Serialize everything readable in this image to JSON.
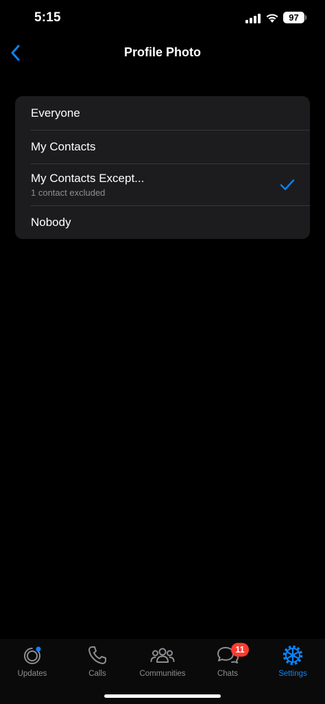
{
  "status_bar": {
    "time": "5:15",
    "battery": "97"
  },
  "nav": {
    "title": "Profile Photo",
    "back_icon": "chevron-left-icon"
  },
  "options": [
    {
      "label": "Everyone",
      "subtitle": "",
      "selected": false
    },
    {
      "label": "My Contacts",
      "subtitle": "",
      "selected": false
    },
    {
      "label": "My Contacts Except...",
      "subtitle": "1 contact excluded",
      "selected": true
    },
    {
      "label": "Nobody",
      "subtitle": "",
      "selected": false
    }
  ],
  "tabs": [
    {
      "label": "Updates",
      "icon": "updates-icon",
      "active": false
    },
    {
      "label": "Calls",
      "icon": "phone-icon",
      "active": false
    },
    {
      "label": "Communities",
      "icon": "communities-icon",
      "active": false
    },
    {
      "label": "Chats",
      "icon": "chat-bubbles-icon",
      "active": false,
      "badge": "11"
    },
    {
      "label": "Settings",
      "icon": "settings-gear-icon",
      "active": true
    }
  ],
  "colors": {
    "accent": "#0a84ff",
    "badge": "#ff3b30",
    "card": "#1c1c1e",
    "background": "#000000"
  }
}
